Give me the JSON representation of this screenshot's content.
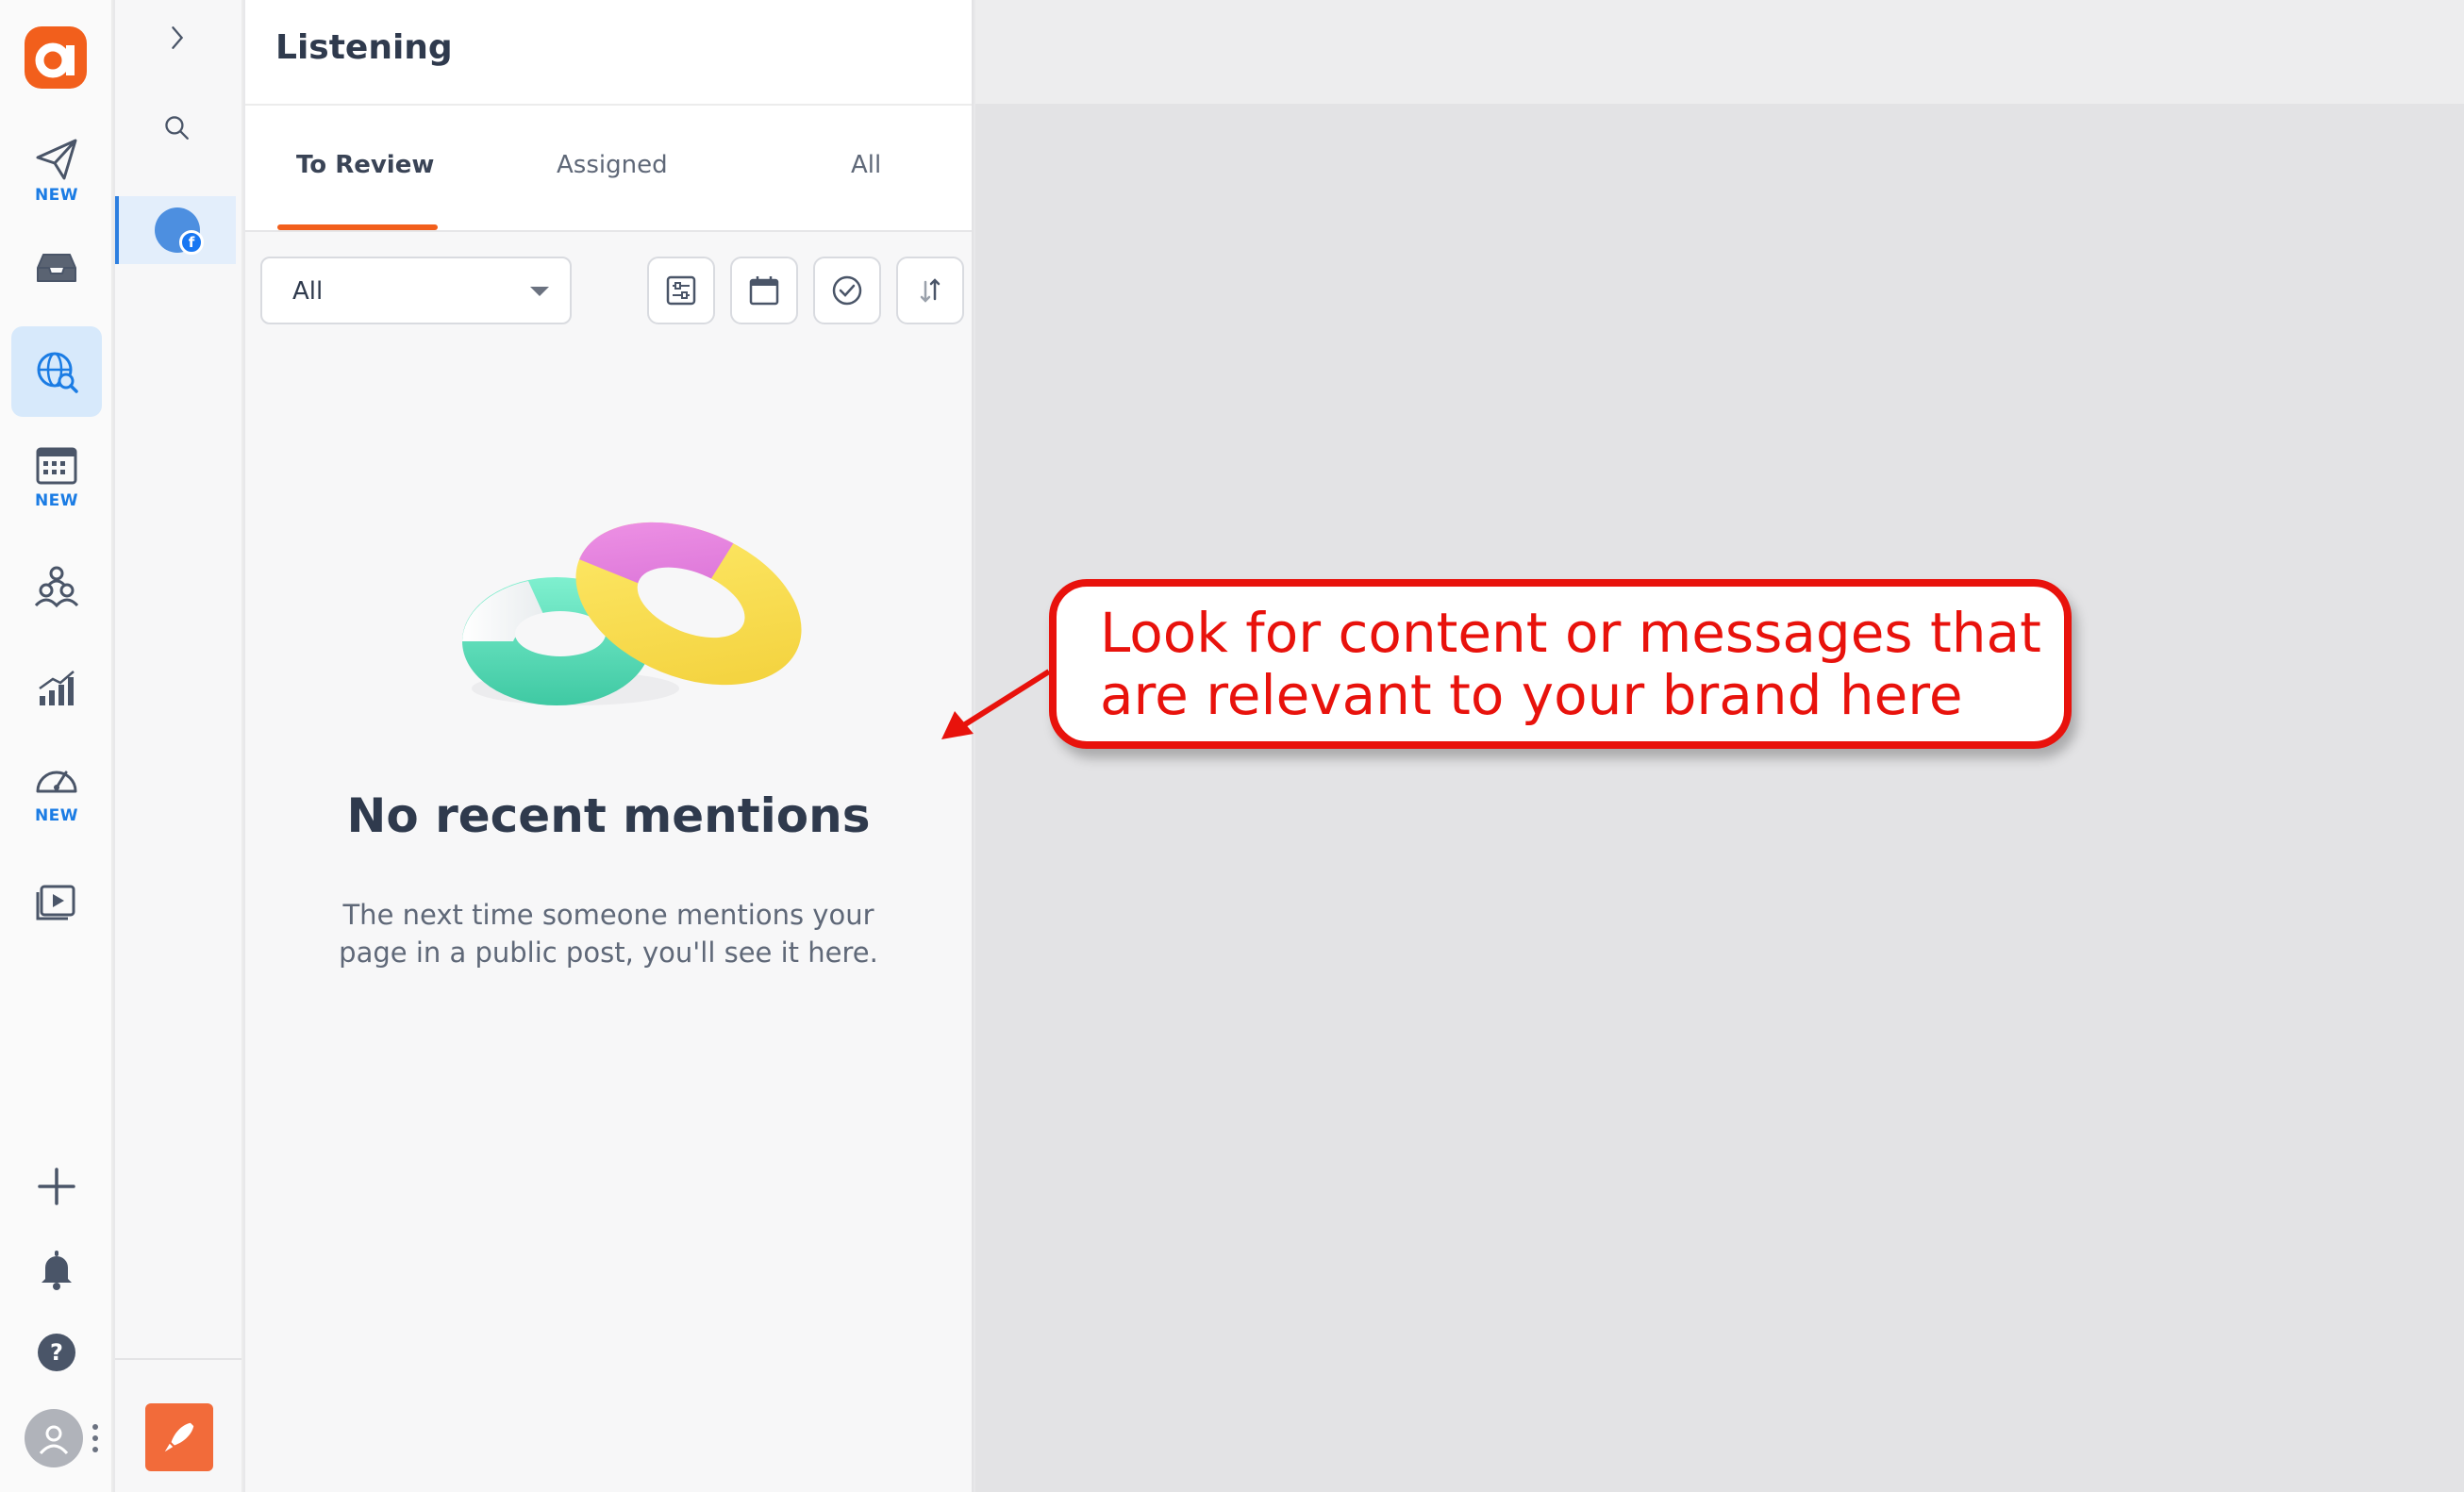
{
  "rail": {
    "items": [
      {
        "icon": "send-icon",
        "badge": "NEW"
      },
      {
        "icon": "inbox-icon",
        "badge": ""
      },
      {
        "icon": "listening-globe-icon",
        "badge": "",
        "active": true
      },
      {
        "icon": "calendar-icon",
        "badge": "NEW"
      },
      {
        "icon": "team-icon",
        "badge": ""
      },
      {
        "icon": "analytics-icon",
        "badge": ""
      },
      {
        "icon": "dashboard-gauge-icon",
        "badge": "NEW"
      },
      {
        "icon": "media-library-icon",
        "badge": ""
      }
    ],
    "bottom": [
      "add-icon",
      "bell-icon",
      "help-icon"
    ]
  },
  "panel": {
    "title": "Listening",
    "tabs": [
      {
        "label": "To Review",
        "active": true
      },
      {
        "label": "Assigned",
        "active": false
      },
      {
        "label": "All",
        "active": false
      }
    ],
    "filter": {
      "selected": "All"
    },
    "empty": {
      "title": "No recent mentions",
      "line1": "The next time someone mentions your",
      "line2": "page in a public post, you'll see it here."
    }
  },
  "annotation": {
    "line1": "Look for content or messages that",
    "line2": "are relevant to your brand here"
  },
  "colors": {
    "accent": "#f25f1c",
    "active_blue": "#1b7ce4",
    "annotation_red": "#e8120c"
  }
}
